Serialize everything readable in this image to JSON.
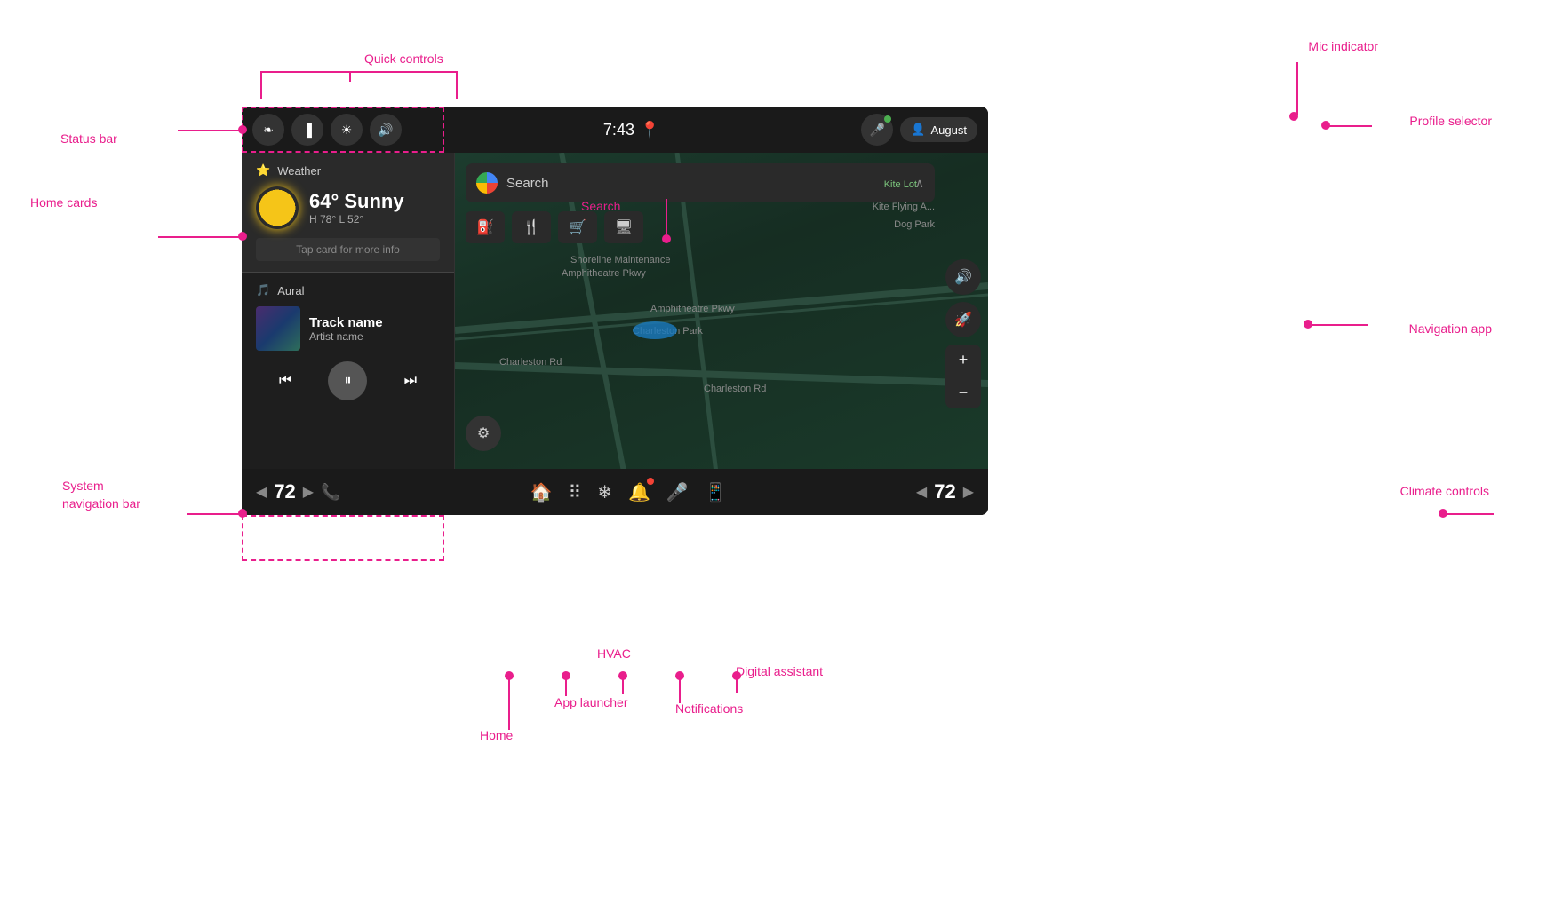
{
  "screen": {
    "time": "7:43",
    "profile_name": "August"
  },
  "status_bar": {
    "bluetooth_label": "bluetooth",
    "signal_label": "signal",
    "brightness_label": "brightness",
    "volume_label": "volume",
    "mic_label": "microphone"
  },
  "weather_card": {
    "title": "Weather",
    "temp": "64° Sunny",
    "range": "H 78° L 52°",
    "tap_hint": "Tap card for more info"
  },
  "music_card": {
    "app_name": "Aural",
    "track_name": "Track name",
    "artist_name": "Artist name"
  },
  "map": {
    "search_placeholder": "Search",
    "road_label_1": "Amphitheatre Pkwy",
    "road_label_2": "Amphitheatre Pkwy",
    "road_label_3": "Charleston Rd",
    "road_label_4": "Charleston Rd",
    "place_label_1": "Kite Lot",
    "place_label_2": "Kite Flying A...",
    "place_label_3": "Dog Park",
    "place_label_4": "Shoreline Maintenance",
    "place_label_5": "Charleston Park",
    "poi_icons": [
      "⛽",
      "🍴",
      "🛒",
      "🖥"
    ]
  },
  "nav_bar": {
    "temp_left": "72",
    "temp_right": "72",
    "home_label": "home",
    "apps_label": "app launcher",
    "hvac_label": "HVAC",
    "notifications_label": "notifications",
    "assistant_label": "digital assistant",
    "phone_label": "phone"
  },
  "annotations": {
    "quick_controls": "Quick controls",
    "status_bar": "Status bar",
    "home_cards": "Home cards",
    "system_nav_bar": "System\nnavigation bar",
    "climate_controls": "Climate controls",
    "navigation_app": "Navigation app",
    "profile_selector": "Profile selector",
    "mic_indicator": "Mic indicator",
    "search": "Search",
    "notifications": "Notifications",
    "home": "Home",
    "app_launcher": "App launcher",
    "hvac": "HVAC",
    "digital_assistant": "Digital assistant"
  }
}
